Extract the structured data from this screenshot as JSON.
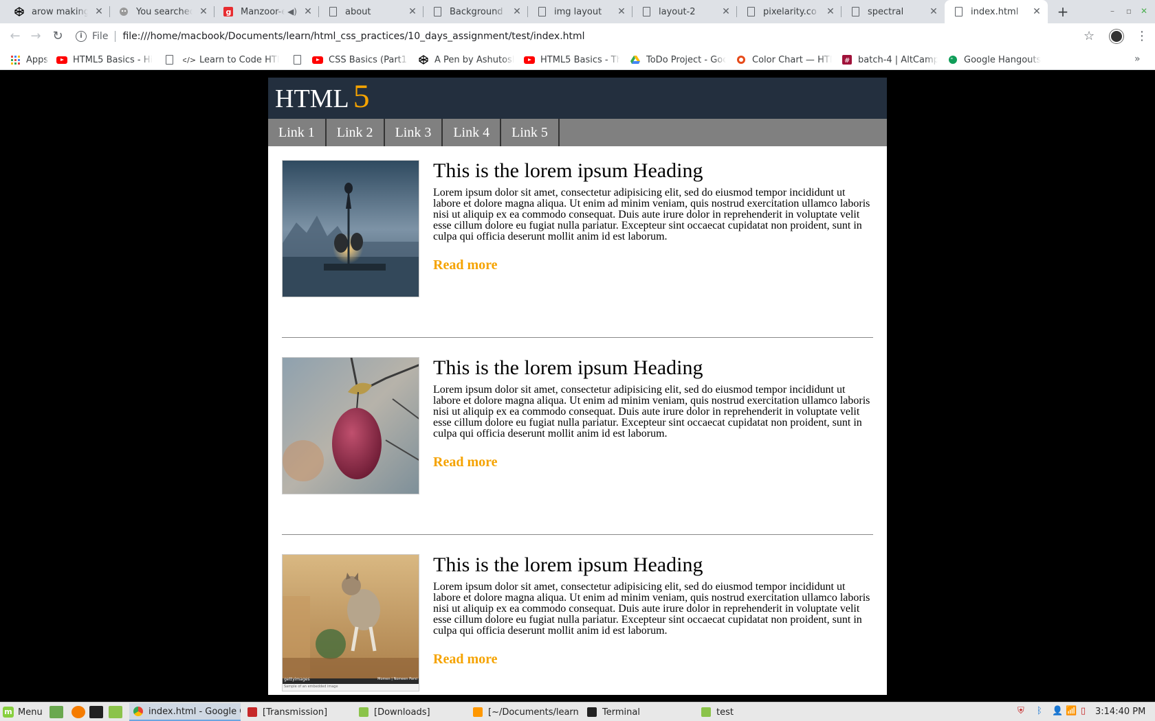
{
  "browser": {
    "tabs": [
      {
        "title": "arow making by",
        "icon": "codepen-icon",
        "icon_color": "#000000"
      },
      {
        "title": "You searched fo",
        "icon": "giphy-icon",
        "icon_color": "#8a8a8a"
      },
      {
        "title": "Manzoor-e",
        "icon": "gaana-icon",
        "icon_color": "#e72c30"
      },
      {
        "title": "about",
        "icon": "document-icon",
        "icon_color": "#5f6368"
      },
      {
        "title": "Background an",
        "icon": "document-icon",
        "icon_color": "#5f6368"
      },
      {
        "title": "img layout",
        "icon": "document-icon",
        "icon_color": "#5f6368"
      },
      {
        "title": "layout-2",
        "icon": "document-icon",
        "icon_color": "#5f6368"
      },
      {
        "title": "pixelarity.co - tr",
        "icon": "document-icon",
        "icon_color": "#5f6368"
      },
      {
        "title": "spectral",
        "icon": "document-icon",
        "icon_color": "#5f6368"
      },
      {
        "title": "index.html",
        "icon": "document-icon",
        "icon_color": "#5f6368"
      }
    ],
    "address": {
      "scheme_label": "File",
      "url": "file:///home/macbook/Documents/learn/html_css_practices/10_days_assignment/test/index.html"
    },
    "bookmarks": [
      {
        "label": "Apps",
        "icon": "apps-grid-icon"
      },
      {
        "label": "HTML5 Basics - Hist",
        "icon": "youtube-icon"
      },
      {
        "label": "",
        "icon": "document-icon"
      },
      {
        "label": "Learn to Code HTML",
        "icon": "code-icon"
      },
      {
        "label": "",
        "icon": "document-icon"
      },
      {
        "label": "CSS Basics (Part1) –",
        "icon": "youtube-icon"
      },
      {
        "label": "A Pen by Ashutosh S",
        "icon": "codepen-icon"
      },
      {
        "label": "HTML5 Basics - The",
        "icon": "youtube-icon"
      },
      {
        "label": "ToDo Project - Goog",
        "icon": "google-drive-icon"
      },
      {
        "label": "Color Chart — HTML",
        "icon": "color-chart-icon"
      },
      {
        "label": "batch-4 | AltCampu",
        "icon": "slack-icon"
      },
      {
        "label": "Google Hangouts",
        "icon": "hangouts-icon"
      }
    ]
  },
  "site": {
    "logo_text": "HTML",
    "logo_number": "5",
    "accent_color": "#f5a300",
    "header_color": "#232f3e",
    "nav": [
      "Link 1",
      "Link 2",
      "Link 3",
      "Link 4",
      "Link 5"
    ],
    "articles": [
      {
        "heading": "This is the lorem ipsum Heading",
        "body": "Lorem ipsum dolor sit amet, consectetur adipisicing elit, sed do eiusmod tempor incididunt ut labore et dolore magna aliqua. Ut enim ad minim veniam, quis nostrud exercitation ullamco laboris nisi ut aliquip ex ea commodo consequat. Duis aute irure dolor in reprehenderit in voluptate velit esse cillum dolore eu fugiat nulla pariatur. Excepteur sint occaecat cupidatat non proident, sunt in culpa qui officia deserunt mollit anim id est laborum.",
        "link": "Read more",
        "image": "cormorant-fisherman-photo"
      },
      {
        "heading": "This is the lorem ipsum Heading",
        "body": "Lorem ipsum dolor sit amet, consectetur adipisicing elit, sed do eiusmod tempor incididunt ut labore et dolore magna aliqua. Ut enim ad minim veniam, quis nostrud exercitation ullamco laboris nisi ut aliquip ex ea commodo consequat. Duis aute irure dolor in reprehenderit in voluptate velit esse cillum dolore eu fugiat nulla pariatur. Excepteur sint occaecat cupidatat non proident, sunt in culpa qui officia deserunt mollit anim id est laborum.",
        "link": "Read more",
        "image": "apple-on-branch-photo"
      },
      {
        "heading": "This is the lorem ipsum Heading",
        "body": "Lorem ipsum dolor sit amet, consectetur adipisicing elit, sed do eiusmod tempor incididunt ut labore et dolore magna aliqua. Ut enim ad minim veniam, quis nostrud exercitation ullamco laboris nisi ut aliquip ex ea commodo consequat. Duis aute irure dolor in reprehenderit in voluptate velit esse cillum dolore eu fugiat nulla pariatur. Excepteur sint occaecat cupidatat non proident, sunt in culpa qui officia deserunt mollit anim id est laborum.",
        "link": "Read more",
        "image": "jumping-kitten-photo",
        "image_credit_left": "gettyimages",
        "image_credit_right": "Momen | Nomeen Parsi",
        "image_caption": "Sample of an embedded image"
      }
    ]
  },
  "taskbar": {
    "menu_label": "Menu",
    "items": [
      {
        "label": "index.html - Google C...",
        "icon": "chrome-icon",
        "active": true
      },
      {
        "label": "[Transmission]",
        "icon": "transmission-icon",
        "active": false
      },
      {
        "label": "[Downloads]",
        "icon": "folder-icon",
        "active": false
      },
      {
        "label": "[~/Documents/learn/...",
        "icon": "sublime-icon",
        "active": false
      },
      {
        "label": "Terminal",
        "icon": "terminal-icon",
        "active": false
      },
      {
        "label": "test",
        "icon": "folder-icon",
        "active": false
      }
    ],
    "clock": "3:14:40 PM"
  }
}
